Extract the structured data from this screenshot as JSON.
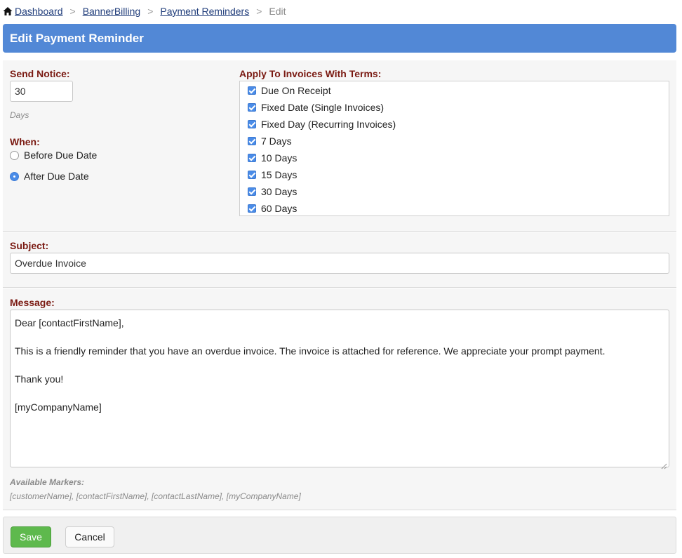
{
  "breadcrumb": {
    "items": [
      "Dashboard",
      "BannerBilling",
      "Payment Reminders"
    ],
    "current": "Edit",
    "separator": ">"
  },
  "page_title": "Edit Payment Reminder",
  "send_notice": {
    "label": "Send Notice:",
    "value": "30",
    "hint": "Days"
  },
  "when": {
    "label": "When:",
    "options": [
      {
        "label": "Before Due Date",
        "checked": false
      },
      {
        "label": "After Due Date",
        "checked": true
      }
    ]
  },
  "terms": {
    "label": "Apply To Invoices With Terms:",
    "items": [
      "Due On Receipt",
      "Fixed Date (Single Invoices)",
      "Fixed Day (Recurring Invoices)",
      "7 Days",
      "10 Days",
      "15 Days",
      "30 Days",
      "60 Days"
    ]
  },
  "subject": {
    "label": "Subject:",
    "value": "Overdue Invoice"
  },
  "message": {
    "label": "Message:",
    "lines": [
      "Dear [contactFirstName],",
      "This is a friendly reminder that you have an overdue invoice. The invoice is attached for reference. We appreciate your prompt payment.",
      "Thank you!",
      "[myCompanyName]"
    ]
  },
  "markers": {
    "label": "Available Markers:",
    "list": "[customerName], [contactFirstName], [contactLastName], [myCompanyName]"
  },
  "actions": {
    "save": "Save",
    "cancel": "Cancel"
  },
  "colors": {
    "title_bar": "#5288d6",
    "label": "#7a1a12",
    "save_button": "#5eb94d",
    "accent": "#4a8ce8"
  }
}
